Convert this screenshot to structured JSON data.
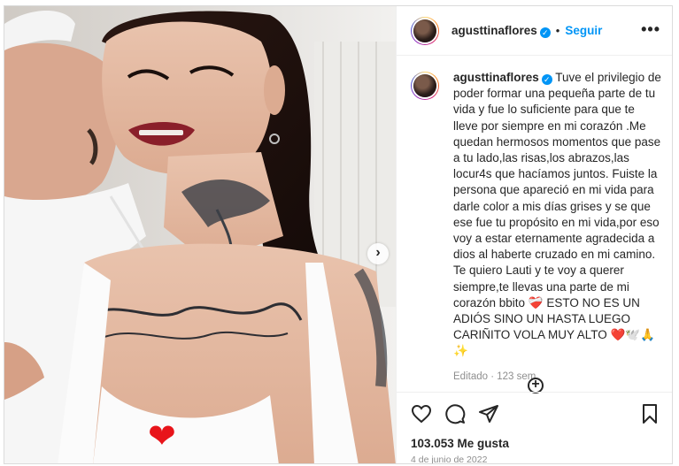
{
  "post": {
    "username": "agusttinaflores",
    "verified_mark": "✓",
    "separator": "•",
    "follow_label": "Seguir",
    "more_icon": "•••",
    "caption": "Tuve el privilegio de poder formar una pequeña parte de tu vida y fue lo suficiente para que te lleve por siempre en mi corazón .Me quedan hermosos momentos que pase a tu lado,las risas,los abrazos,las locur4s que hacíamos juntos. Fuiste la persona que apareció en mi vida para darle color a mis días grises y se que ese fue tu propósito en mi vida,por eso voy a estar eternamente agradecida a dios al haberte cruzado en mi camino. Te quiero Lauti y te voy a querer siempre,te llevas una parte de mi corazón bbito ❤️‍🩹 ESTO NO ES UN ADIÓS SINO UN HASTA LUEGO CARIÑITO VOLA MUY ALTO ❤️🕊️🙏 ✨",
    "edited_meta": "Editado · 123 sem",
    "likes": "103.053 Me gusta",
    "date": "4 de junio de 2022",
    "photo_heart": "❤",
    "carousel_arrow": "›"
  },
  "colors": {
    "accent": "#0095f6",
    "text": "#262626",
    "muted": "#8e8e8e",
    "heart": "#e8141a"
  },
  "icons": [
    "more-icon",
    "verified-icon",
    "like-icon",
    "comment-icon",
    "share-icon",
    "save-icon",
    "add-comment-icon",
    "carousel-next-icon"
  ]
}
